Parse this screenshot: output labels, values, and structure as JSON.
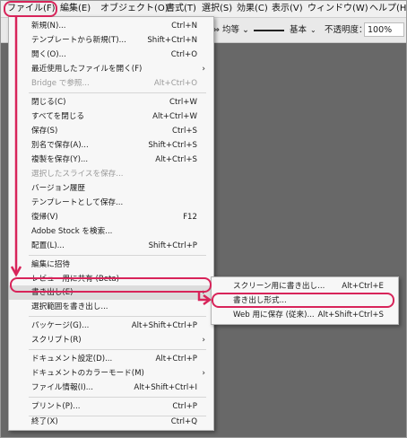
{
  "menubar": {
    "items": [
      {
        "label": "ファイル(F)"
      },
      {
        "label": "編集(E)"
      },
      {
        "label": "オブジェクト(O)"
      },
      {
        "label": "書式(T)"
      },
      {
        "label": "選択(S)"
      },
      {
        "label": "効果(C)"
      },
      {
        "label": "表示(V)"
      },
      {
        "label": "ウィンドウ(W)"
      },
      {
        "label": "ヘルプ(H)"
      }
    ]
  },
  "control_bar": {
    "dropdown1": "⇔ 均等 ⌄",
    "stroke_style": "基本",
    "chevron": "⌄",
    "opacity_label": "不透明度：",
    "opacity_value": "100%"
  },
  "file_menu": {
    "items": [
      {
        "label": "新規(N)...",
        "shortcut": "Ctrl+N"
      },
      {
        "label": "テンプレートから新規(T)...",
        "shortcut": "Shift+Ctrl+N"
      },
      {
        "label": "開く(O)...",
        "shortcut": "Ctrl+O"
      },
      {
        "label": "最近使用したファイルを開く(F)",
        "shortcut": "",
        "arrow": "›"
      },
      {
        "label": "Bridge で参照...",
        "shortcut": "Alt+Ctrl+O"
      },
      {
        "label": "閉じる(C)",
        "shortcut": "Ctrl+W"
      },
      {
        "label": "すべてを閉じる",
        "shortcut": "Alt+Ctrl+W"
      },
      {
        "label": "保存(S)",
        "shortcut": "Ctrl+S"
      },
      {
        "label": "別名で保存(A)...",
        "shortcut": "Shift+Ctrl+S"
      },
      {
        "label": "複製を保存(Y)...",
        "shortcut": "Alt+Ctrl+S"
      },
      {
        "label": "選択したスライスを保存...",
        "shortcut": ""
      },
      {
        "label": "バージョン履歴",
        "shortcut": ""
      },
      {
        "label": "テンプレートとして保存...",
        "shortcut": ""
      },
      {
        "label": "復帰(V)",
        "shortcut": "F12"
      },
      {
        "label": "Adobe Stock を検索...",
        "shortcut": ""
      },
      {
        "label": "配置(L)...",
        "shortcut": "Shift+Ctrl+P"
      },
      {
        "label": "編集に招待",
        "shortcut": ""
      },
      {
        "label": "レビュー用に共有 (Beta)",
        "shortcut": ""
      },
      {
        "label": "書き出し(E)",
        "shortcut": "",
        "arrow": "›"
      },
      {
        "label": "選択範囲を書き出し...",
        "shortcut": ""
      },
      {
        "label": "パッケージ(G)...",
        "shortcut": "Alt+Shift+Ctrl+P"
      },
      {
        "label": "スクリプト(R)",
        "shortcut": "",
        "arrow": "›"
      },
      {
        "label": "ドキュメント設定(D)...",
        "shortcut": "Alt+Ctrl+P"
      },
      {
        "label": "ドキュメントのカラーモード(M)",
        "shortcut": "",
        "arrow": "›"
      },
      {
        "label": "ファイル情報(I)...",
        "shortcut": "Alt+Shift+Ctrl+I"
      },
      {
        "label": "プリント(P)...",
        "shortcut": "Ctrl+P"
      },
      {
        "label": "終了(X)",
        "shortcut": "Ctrl+Q"
      }
    ]
  },
  "export_submenu": {
    "items": [
      {
        "label": "スクリーン用に書き出し...",
        "shortcut": "Alt+Ctrl+E"
      },
      {
        "label": "書き出し形式...",
        "shortcut": ""
      },
      {
        "label": "Web 用に保存 (従来)...",
        "shortcut": "Alt+Shift+Ctrl+S"
      }
    ]
  },
  "annotation_color": "#d8245a"
}
